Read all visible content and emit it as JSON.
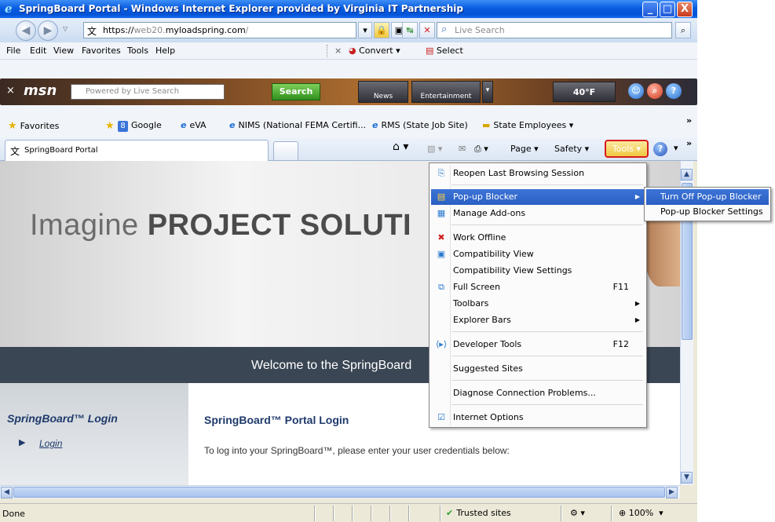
{
  "window": {
    "title": "SpringBoard Portal - Windows Internet Explorer provided by Virginia IT Partnership",
    "min": "_",
    "max": "□",
    "close": "X"
  },
  "address": {
    "url_prefix": "https://",
    "url_host_dim": "web20.",
    "url_host": "myloadspring.com",
    "url_suffix": "/",
    "search_placeholder": "Live Search"
  },
  "menubar": {
    "items": [
      "File",
      "Edit",
      "View",
      "Favorites",
      "Tools",
      "Help"
    ],
    "close": "×",
    "convert": "Convert",
    "select": "Select"
  },
  "msn": {
    "logo": "msn",
    "search_placeholder": "Powered by  Live Search",
    "search_button": "Search",
    "news": "News",
    "entertainment": "Entertainment",
    "temperature": "40°F"
  },
  "favorites": {
    "favorites_label": "Favorites",
    "items": [
      "Google",
      "eVA",
      "NIMS (National FEMA Certifi...",
      "RMS (State Job Site)",
      "State Employees"
    ]
  },
  "tabs": {
    "active_tab": "SpringBoard Portal"
  },
  "commandbar": {
    "page": "Page",
    "safety": "Safety",
    "tools": "Tools"
  },
  "content": {
    "hero_light": "Imagine ",
    "hero_bold": "PROJECT SOLUTI",
    "welcome": "Welcome to the SpringBoard",
    "left_heading": "SpringBoard™ Login",
    "left_link": "Login",
    "main_heading": "SpringBoard™ Portal Login",
    "main_text": "To log into your SpringBoard™, please enter your user credentials below:"
  },
  "status": {
    "text": "Done",
    "zone": "Trusted sites",
    "zoom": "100%"
  },
  "tools_menu": {
    "items": [
      {
        "label": "Reopen Last Browsing Session",
        "icon": "session-icon"
      },
      {
        "label": "Pop-up Blocker",
        "icon": "popup-icon",
        "submenu": true
      },
      {
        "label": "Manage Add-ons",
        "icon": "addons-icon"
      },
      {
        "label": "Work Offline",
        "icon": "offline-icon"
      },
      {
        "label": "Compatibility View",
        "icon": "compat-icon"
      },
      {
        "label": "Compatibility View Settings"
      },
      {
        "label": "Full Screen",
        "icon": "fullscreen-icon",
        "shortcut": "F11"
      },
      {
        "label": "Toolbars",
        "submenu": true
      },
      {
        "label": "Explorer Bars",
        "submenu": true
      },
      {
        "label": "Developer Tools",
        "icon": "devtools-icon",
        "shortcut": "F12"
      },
      {
        "label": "Suggested Sites"
      },
      {
        "label": "Diagnose Connection Problems..."
      },
      {
        "label": "Internet Options",
        "icon": "options-icon"
      }
    ]
  },
  "popup_submenu": {
    "items": [
      "Turn Off Pop-up Blocker",
      "Pop-up Blocker Settings"
    ]
  }
}
